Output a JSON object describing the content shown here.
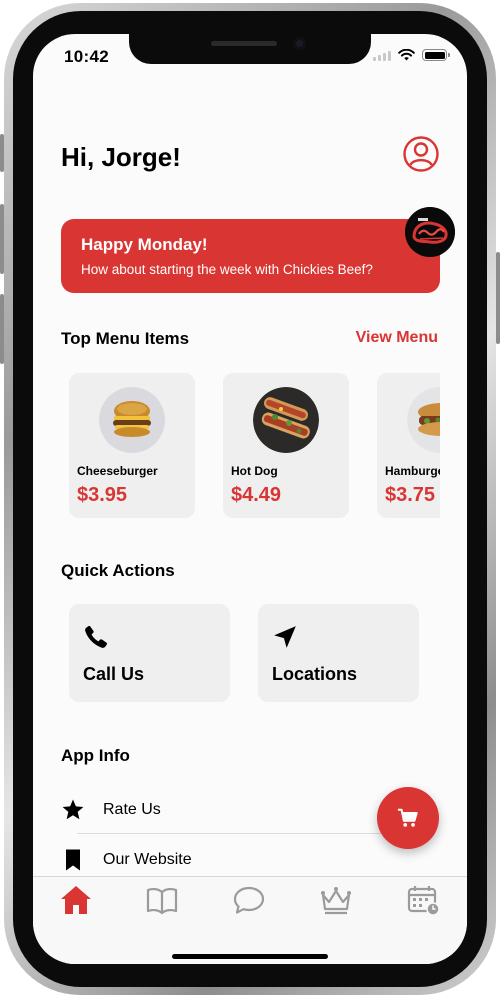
{
  "status_bar": {
    "time": "10:42"
  },
  "header": {
    "greeting": "Hi, Jorge!"
  },
  "promo": {
    "title": "Happy Monday!",
    "subtitle": "How about starting the week with Chickies Beef?"
  },
  "top_menu": {
    "title": "Top Menu Items",
    "view_menu_label": "View Menu",
    "items": [
      {
        "name": "Cheeseburger",
        "price": "$3.95"
      },
      {
        "name": "Hot Dog",
        "price": "$4.49"
      },
      {
        "name": "Hamburger",
        "price": "$3.75"
      }
    ]
  },
  "quick_actions": {
    "title": "Quick Actions",
    "items": [
      {
        "label": "Call Us",
        "icon": "phone-icon"
      },
      {
        "label": "Locations",
        "icon": "location-arrow-icon"
      }
    ]
  },
  "app_info": {
    "title": "App Info",
    "items": [
      {
        "label": "Rate Us",
        "icon": "star-icon"
      },
      {
        "label": "Our Website",
        "icon": "bookmark-icon"
      }
    ]
  },
  "tabs": [
    {
      "icon": "home-icon",
      "active": true
    },
    {
      "icon": "menu-book-icon",
      "active": false
    },
    {
      "icon": "chat-bubble-icon",
      "active": false
    },
    {
      "icon": "crown-icon",
      "active": false
    },
    {
      "icon": "calendar-icon",
      "active": false
    }
  ],
  "colors": {
    "accent": "#d93532",
    "card_background": "#efefef",
    "tab_inactive": "#9b9b9b"
  }
}
